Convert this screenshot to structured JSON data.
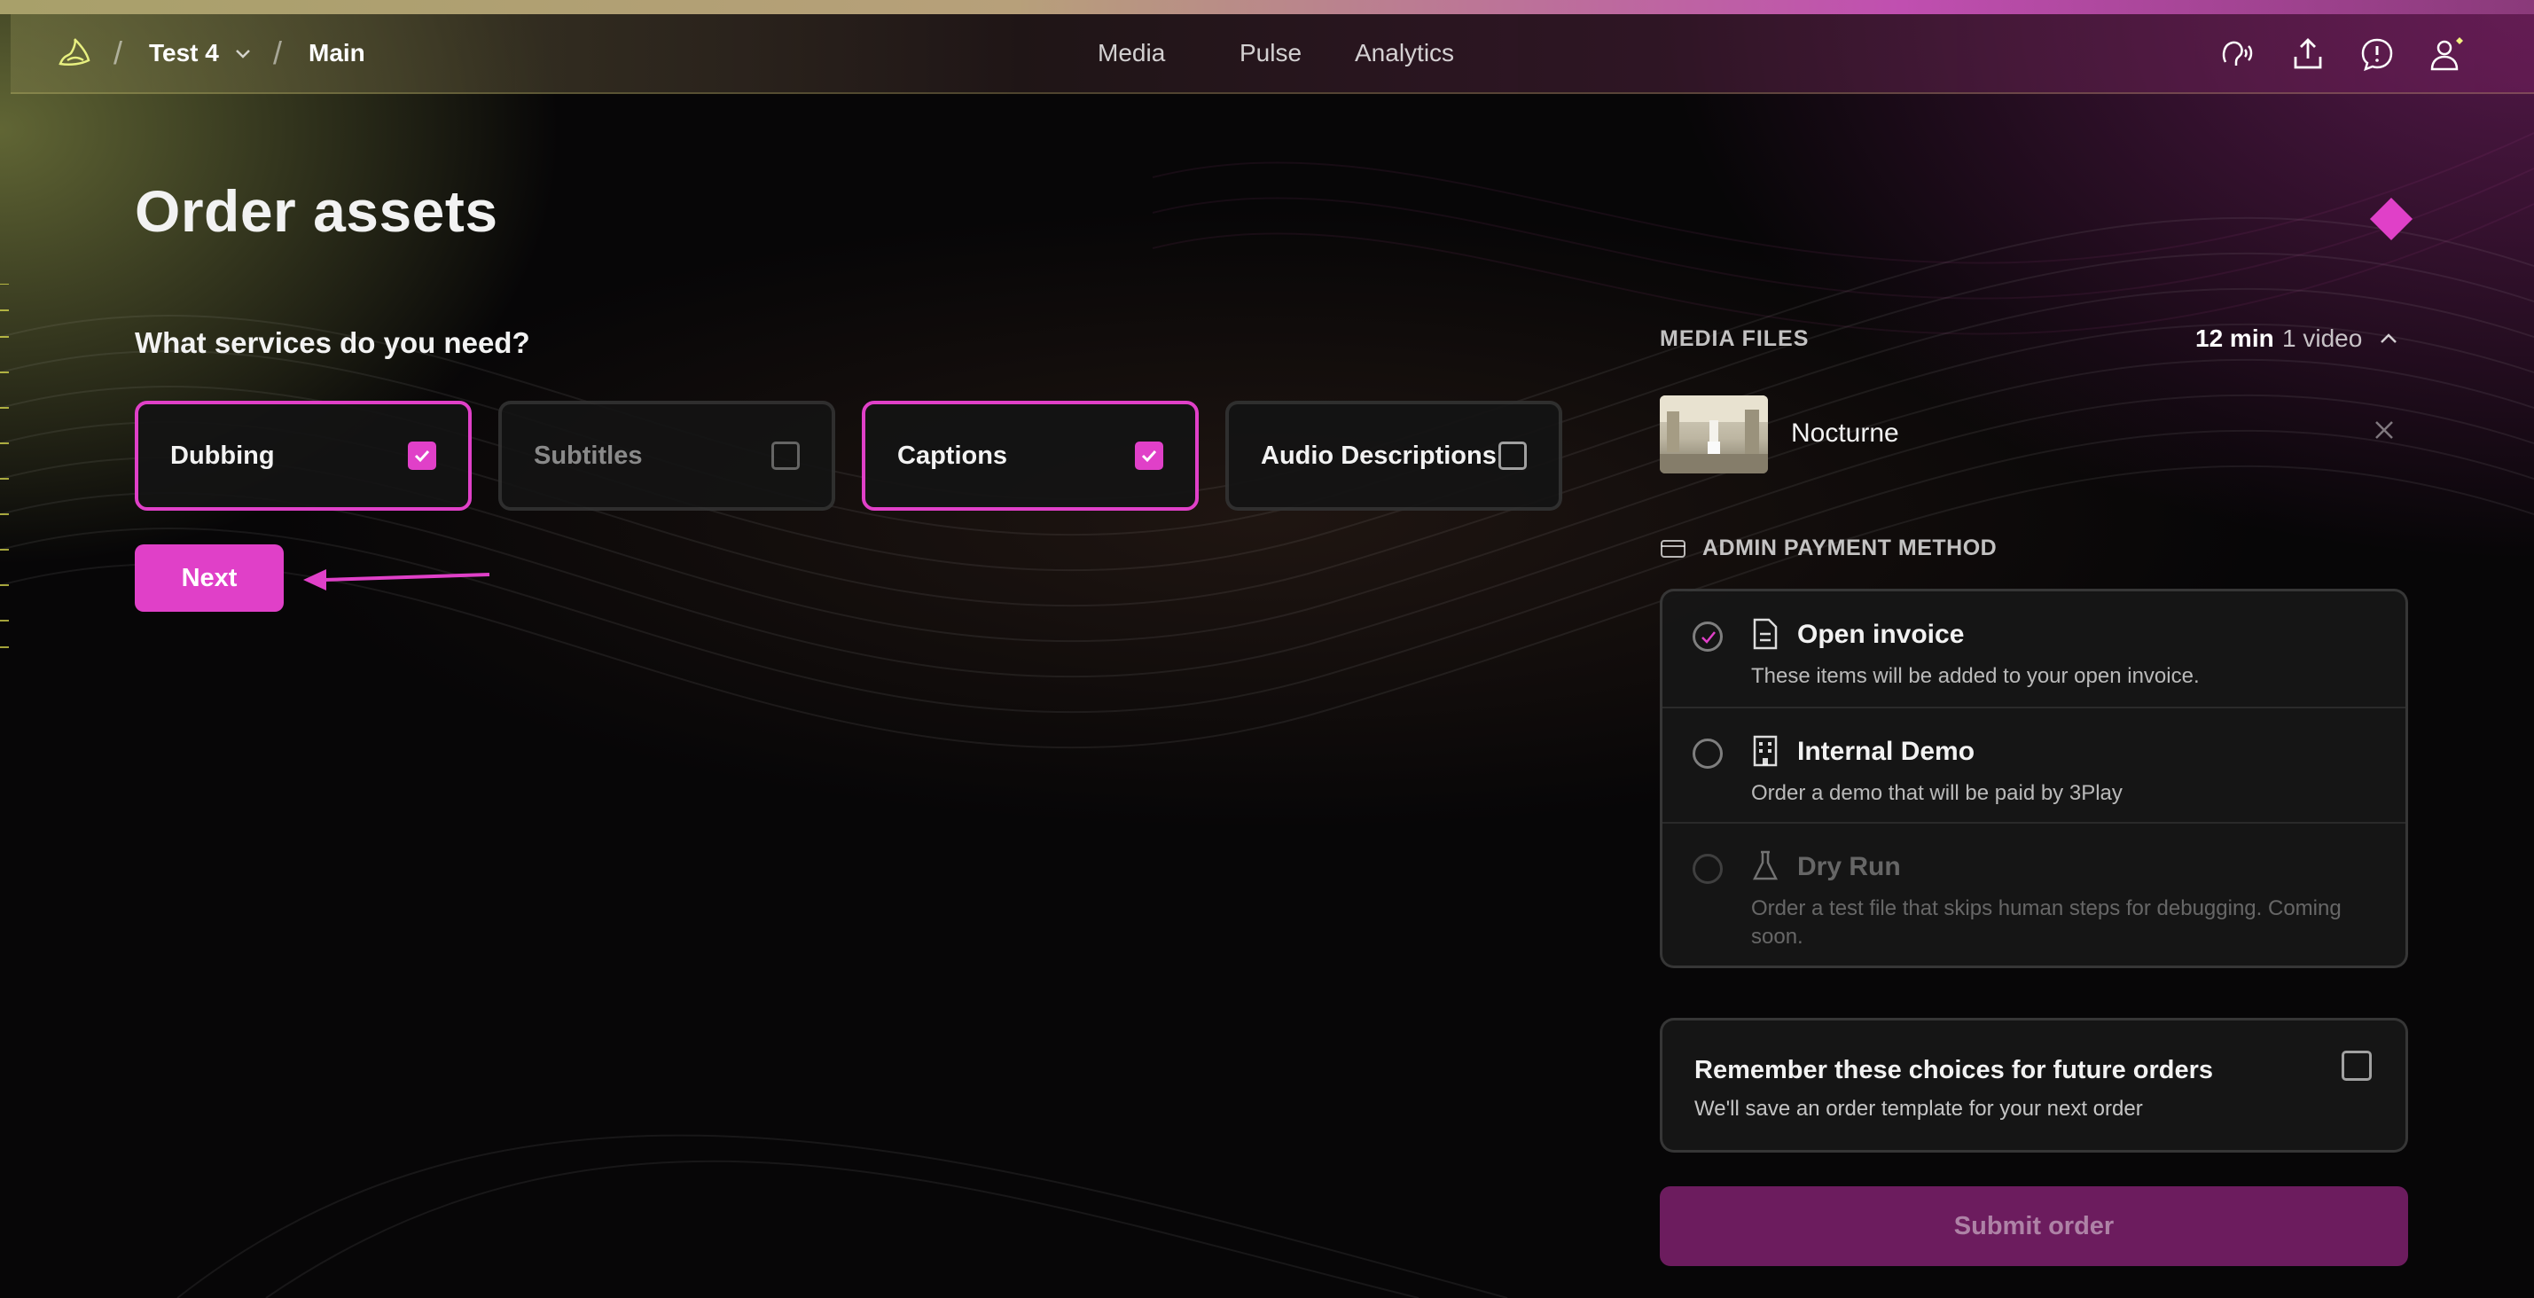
{
  "colors": {
    "accent": "#e040c8",
    "submit_bg": "#6c1c5e",
    "panel_bg": "#161616"
  },
  "nav": {
    "logo_icon": "app-logo-icon",
    "breadcrumb": {
      "workspace": "Test 4",
      "project": "Main",
      "separator": "/"
    },
    "links": [
      "Media",
      "Pulse",
      "Analytics"
    ],
    "icons": [
      "voice-icon",
      "upload-icon",
      "feedback-icon",
      "user-icon"
    ]
  },
  "page": {
    "title": "Order assets",
    "question": "What services do you need?"
  },
  "services": [
    {
      "label": "Dubbing",
      "checked": true
    },
    {
      "label": "Subtitles",
      "checked": false
    },
    {
      "label": "Captions",
      "checked": true
    },
    {
      "label": "Audio Descriptions",
      "checked": false
    }
  ],
  "next_label": "Next",
  "media_files": {
    "title": "MEDIA FILES",
    "duration": "12 min",
    "count": "1 video",
    "items": [
      {
        "name": "Nocturne"
      }
    ]
  },
  "payment": {
    "title": "ADMIN PAYMENT METHOD",
    "options": [
      {
        "title": "Open invoice",
        "desc": "These items will be added to your open invoice.",
        "icon": "document-icon",
        "selected": true,
        "disabled": false
      },
      {
        "title": "Internal Demo",
        "desc": "Order a demo that will be paid by 3Play",
        "icon": "building-icon",
        "selected": false,
        "disabled": false
      },
      {
        "title": "Dry Run",
        "desc": "Order a test file that skips human steps for debugging. Coming soon.",
        "icon": "flask-icon",
        "selected": false,
        "disabled": true
      }
    ]
  },
  "remember": {
    "title": "Remember these choices for future orders",
    "desc": "We'll save an order template for your next order",
    "checked": false
  },
  "submit_label": "Submit order"
}
